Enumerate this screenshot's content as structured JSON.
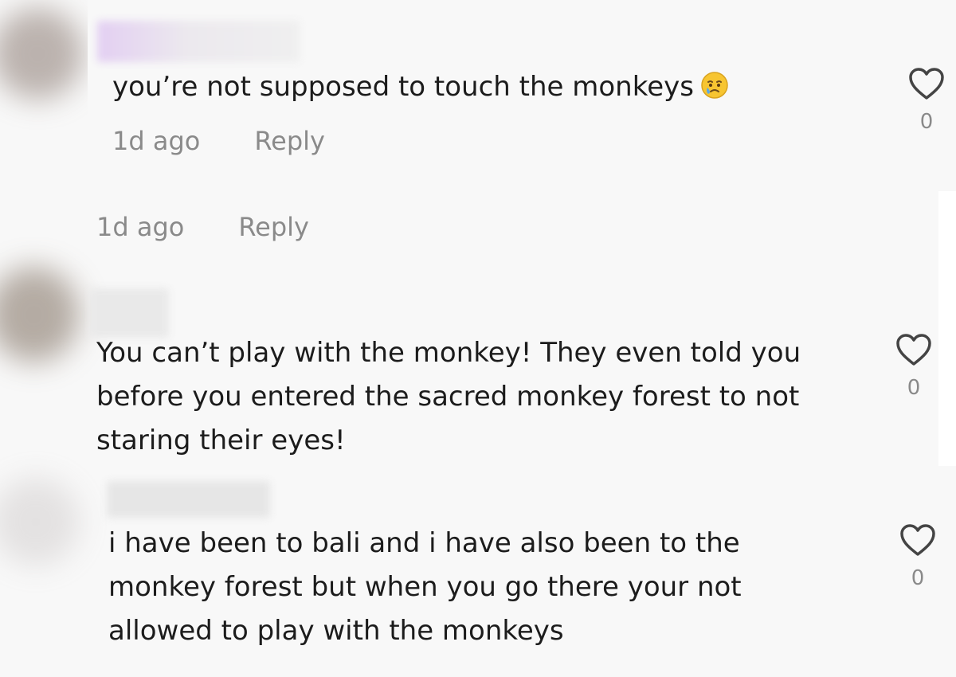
{
  "comments": [
    {
      "text": "you’re not supposed to touch the monkeys",
      "emoji": "crying-face",
      "time": "1d ago",
      "reply_label": "Reply",
      "like_count": "0"
    },
    {
      "time": "1d ago",
      "reply_label": "Reply"
    },
    {
      "text_lines": [
        "You can’t play with the monkey! They even told you",
        "before you entered the sacred monkey forest to not",
        "staring their eyes!"
      ],
      "like_count": "0"
    },
    {
      "text_lines": [
        "i have been to bali and i have also been to the",
        "monkey forest but when you go there your not",
        "allowed to play with the monkeys"
      ],
      "like_count": "0"
    }
  ],
  "colors": {
    "background": "#f8f8f8",
    "text": "#1c1c1c",
    "meta_text": "#8a8a8a",
    "icon_stroke": "#444444"
  }
}
